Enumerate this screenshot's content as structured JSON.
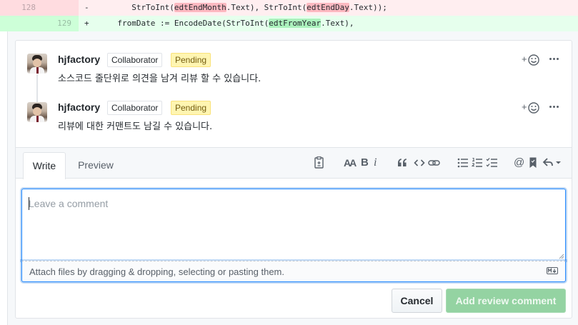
{
  "diff": {
    "deleted_line": {
      "old_number": "128",
      "new_number": "",
      "sign": "-",
      "code_prefix": "    StrToInt(",
      "token1": "edtEndMonth",
      "code_mid": ".Text), StrToInt(",
      "token2": "edtEndDay",
      "code_suffix": ".Text));"
    },
    "added_line": {
      "old_number": "",
      "new_number": "129",
      "sign": "+",
      "code_prefix": "  fromDate := EncodeDate(StrToInt(",
      "token1": "edtFromYear",
      "code_suffix": ".Text),"
    }
  },
  "comments": [
    {
      "author": "hjfactory",
      "role_label": "Collaborator",
      "status_label": "Pending",
      "body": "소스코드 줄단위로 의견을 남겨 리뷰 할 수 있습니다.",
      "reaction_plus": "+",
      "icons": [
        "smiley-icon",
        "kebab-horizontal-icon"
      ]
    },
    {
      "author": "hjfactory",
      "role_label": "Collaborator",
      "status_label": "Pending",
      "body": "리뷰에 대한 커맨트도 남길 수 있습니다.",
      "reaction_plus": "+",
      "icons": [
        "smiley-icon",
        "kebab-horizontal-icon"
      ]
    }
  ],
  "editor": {
    "tabs": [
      "Write",
      "Preview"
    ],
    "active_tab": "Write",
    "toolbar": {
      "heading_label": "AA",
      "bold_label": "B",
      "italic_label": "i",
      "mention_label": "@",
      "icons": [
        "file-diff-icon",
        "heading-icon",
        "bold-icon",
        "italic-icon",
        "quote-icon",
        "code-icon",
        "link-icon",
        "unordered-list-icon",
        "ordered-list-icon",
        "task-list-icon",
        "mention-icon",
        "bookmark-icon",
        "reply-icon"
      ]
    },
    "placeholder": "Leave a comment",
    "value": "",
    "attach_hint": "Attach files by dragging & dropping, selecting or pasting them.",
    "markdown_icon": "markdown-icon"
  },
  "actions": {
    "cancel_label": "Cancel",
    "submit_label": "Add review comment"
  },
  "colors": {
    "pending_bg": "#fff5b1",
    "submit_bg": "#94d3a2",
    "focus_border": "#2188ff"
  }
}
